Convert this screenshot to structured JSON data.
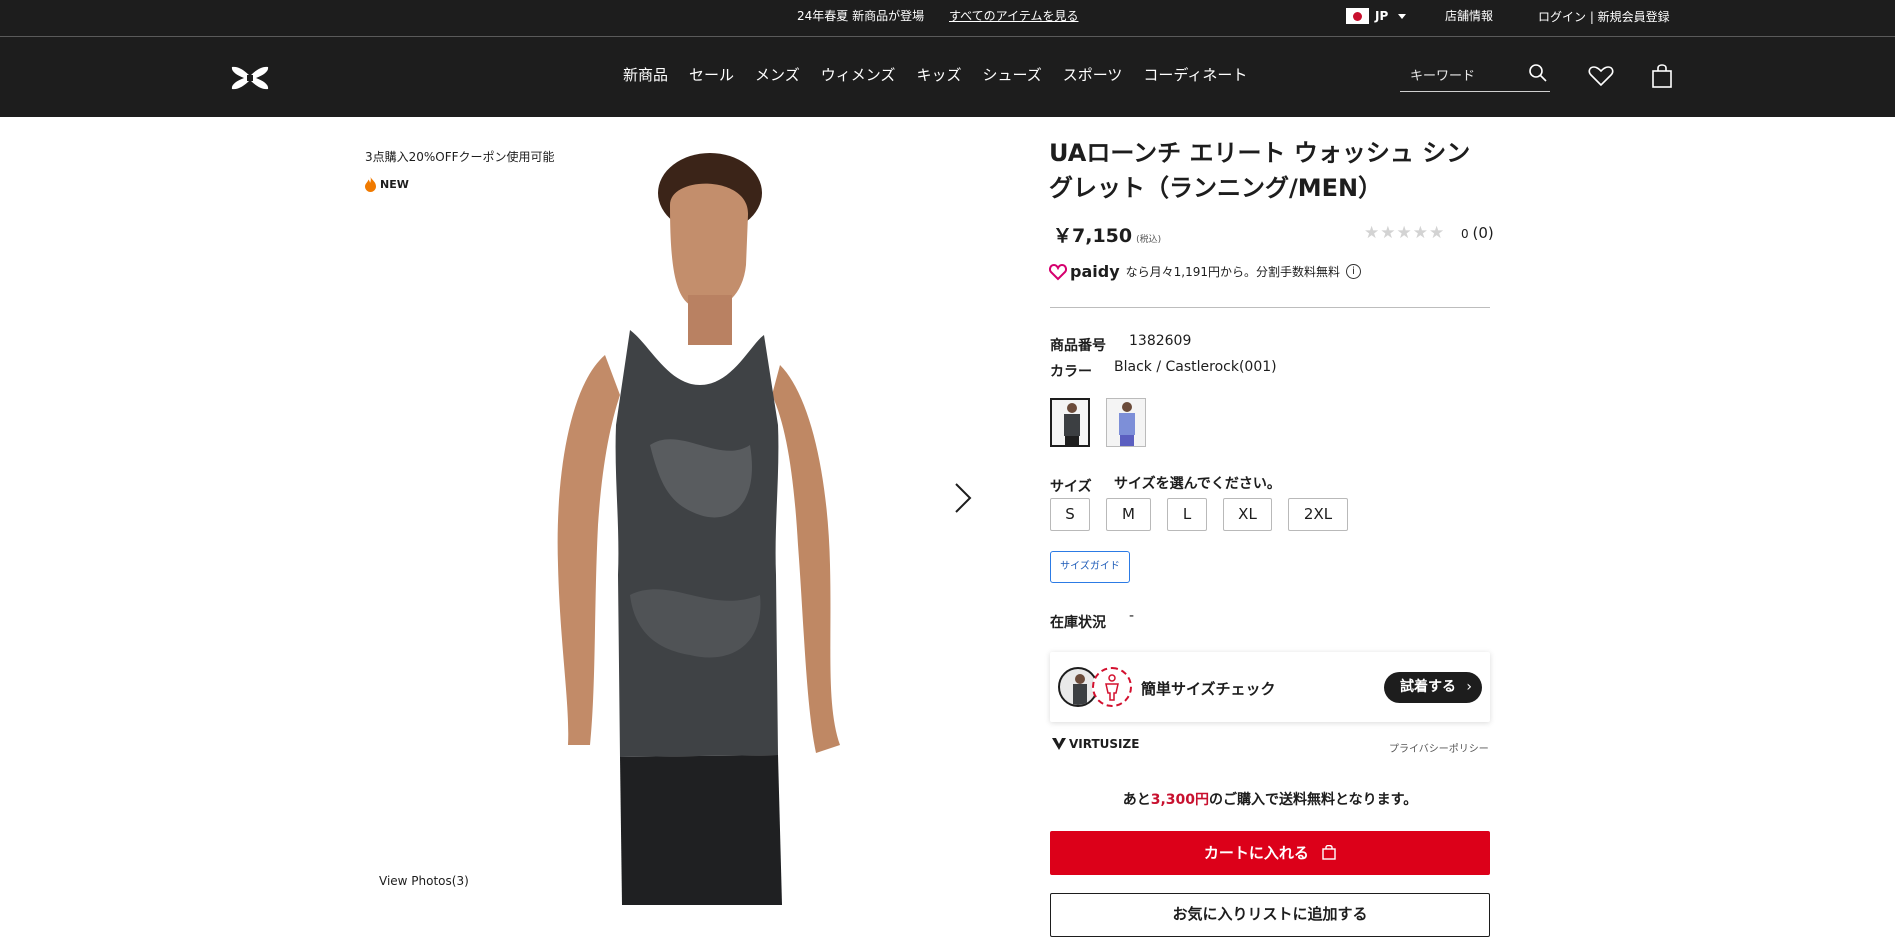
{
  "topbar": {
    "promo": "24年春夏 新商品が登場",
    "promo_link": "すべてのアイテムを見る",
    "lang": "JP",
    "store": "店舗情報",
    "login": "ログイン | 新規会員登録"
  },
  "nav": {
    "menu": [
      "新商品",
      "セール",
      "メンズ",
      "ウィメンズ",
      "キッズ",
      "シューズ",
      "スポーツ",
      "コーディネート"
    ],
    "search_placeholder": "キーワード"
  },
  "gallery": {
    "coupon": "3点購入20%OFFクーポン使用可能",
    "badge": "NEW",
    "view_photos": "View Photos(3)"
  },
  "product": {
    "title": "UAローンチ エリート ウォッシュ シングレット（ランニング/MEN）",
    "price": "￥7,150",
    "tax": "(税込)",
    "rating_value": "0",
    "rating_count": "(0)",
    "stars_filled": 0,
    "paidy_brand": "paidy",
    "paidy_text": "なら月々1,191円から。分割手数料無料",
    "number_label": "商品番号",
    "number_value": "1382609",
    "color_label": "カラー",
    "color_value": "Black / Castlerock(001)",
    "size_label": "サイズ",
    "size_prompt": "サイズを選んでください。",
    "sizes": [
      "S",
      "M",
      "L",
      "XL",
      "2XL"
    ],
    "size_guide": "サイズガイド",
    "stock_label": "在庫状況",
    "stock_value": "-",
    "virtusize_text": "簡単サイズチェック",
    "virtusize_button": "試着する",
    "virtusize_brand": "VIRTUSIZE",
    "privacy": "プライバシーポリシー",
    "freeship_prefix": "あと",
    "freeship_amount": "3,300円",
    "freeship_suffix": "のご購入で送料無料となります。",
    "add_to_cart": "カートに入れる",
    "wishlist": "お気に入りリストに追加する"
  },
  "colors": {
    "accent_red": "#dc0019",
    "dark": "#1d1d1d"
  }
}
